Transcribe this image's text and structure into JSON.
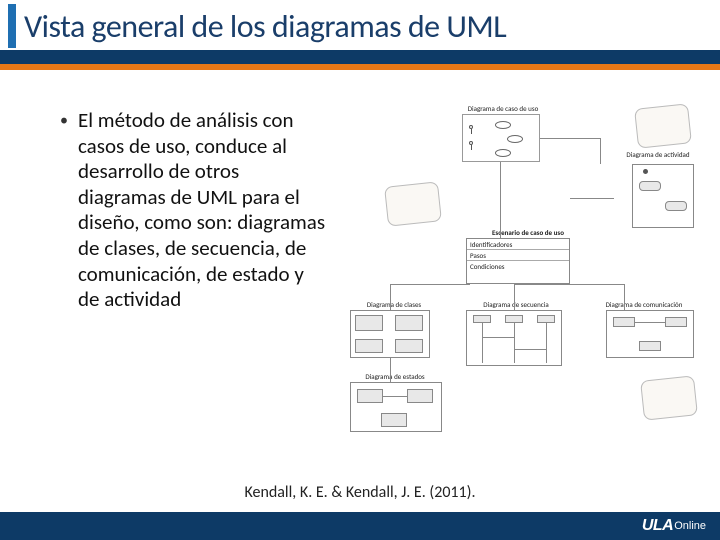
{
  "slide": {
    "title": "Vista general de los diagramas de UML",
    "bullet_text": "El método de análisis con casos de uso, conduce al desarrollo de otros diagramas de UML para el diseño, como son: diagramas de clases, de secuencia, de comunicación, de estado y de actividad",
    "citation": "Kendall, K. E. & Kendall, J. E. (2011)."
  },
  "diagram_labels": {
    "usecase": "Diagrama de caso de uso",
    "activity": "Diagrama de actividad",
    "scenario": "Escenario de caso de uso",
    "identifiers": "Identificadores",
    "steps": "Pasos",
    "conditions": "Condiciones",
    "classes": "Diagrama de clases",
    "sequence": "Diagrama de secuencia",
    "communication": "Diagrama de comunicación",
    "states": "Diagrama de estados"
  },
  "footer": {
    "brand": "ULA",
    "sub": "Online"
  }
}
